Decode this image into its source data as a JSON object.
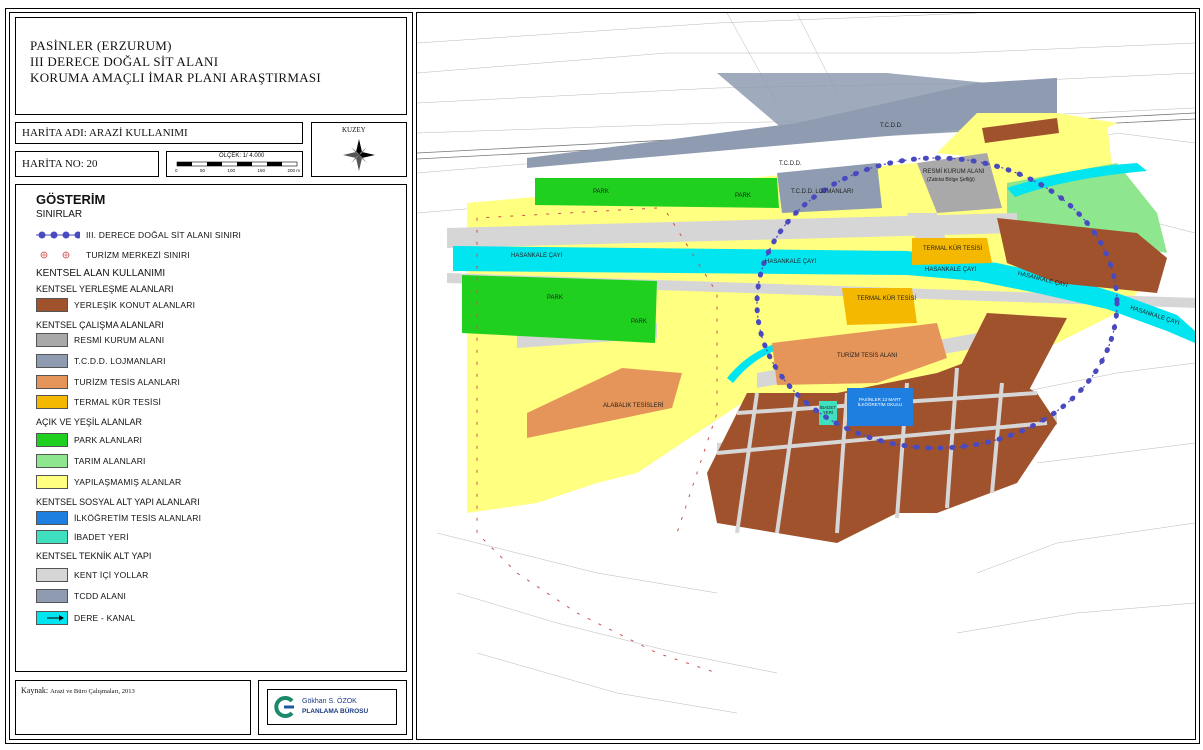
{
  "header": {
    "title_lines": [
      "PASİNLER (ERZURUM)",
      "III DERECE DOĞAL SİT ALANI",
      "KORUMA AMAÇLI İMAR PLANI ARAŞTIRMASI"
    ]
  },
  "map_name": "HARİTA ADI: ARAZİ KULLANIMI",
  "map_no": "HARİTA NO: 20",
  "scale": {
    "label": "ÖLÇEK: 1/ 4.000",
    "ticks": [
      "0",
      "50",
      "100",
      "150",
      "200 m"
    ]
  },
  "north": {
    "label": "KUZEY",
    "icon": "compass-rose-icon"
  },
  "legend": {
    "title": "GÖSTERİM",
    "boundaries_heading": "SINIRLAR",
    "boundaries": [
      {
        "label": "III. DERECE DOĞAL SİT ALANI SINIRI",
        "color": "#4a4ac0"
      },
      {
        "label": "TURİZM MERKEZİ SINIRI",
        "color": "#d05050"
      }
    ],
    "urban_heading": "KENTSEL ALAN KULLANIMI",
    "sections": [
      {
        "heading": "KENTSEL YERLEŞME ALANLARI",
        "items": [
          {
            "label": "YERLEŞİK KONUT ALANLARI",
            "color": "#a0522d"
          }
        ]
      },
      {
        "heading": "KENTSEL ÇALIŞMA ALANLARI",
        "items": [
          {
            "label": "RESMİ KURUM ALANI",
            "color": "#a9a9a9"
          },
          {
            "label": "T.C.D.D. LOJMANLARI",
            "color": "#8e9bb0"
          },
          {
            "label": "TURİZM TESİS ALANLARI",
            "color": "#e6955a"
          },
          {
            "label": "TERMAL KÜR TESİSİ",
            "color": "#f5b800"
          }
        ]
      },
      {
        "heading": "AÇIK VE YEŞİL ALANLAR",
        "items": [
          {
            "label": "PARK ALANLARI",
            "color": "#1fd01f"
          },
          {
            "label": "TARIM ALANLARI",
            "color": "#8ee68e"
          },
          {
            "label": "YAPILAŞMAMIŞ ALANLAR",
            "color": "#ffff80"
          }
        ]
      },
      {
        "heading": "KENTSEL SOSYAL ALT YAPI ALANLARI",
        "items": [
          {
            "label": "İLKÖĞRETİM TESİS ALANLARI",
            "color": "#1f7fe0"
          },
          {
            "label": "İBADET YERİ",
            "color": "#3fe0c0"
          }
        ]
      },
      {
        "heading": "KENTSEL TEKNİK ALT YAPI",
        "items": [
          {
            "label": "KENT İÇİ YOLLAR",
            "color": "#d6d6d6"
          },
          {
            "label": "TCDD ALANI",
            "color": "#8e9bb0"
          },
          {
            "label": "DERE - KANAL",
            "color": "#00e5f0"
          }
        ]
      }
    ]
  },
  "source": {
    "label": "Kaynak:",
    "text": "Arazi ve Büro Çalışmaları, 2013"
  },
  "company": {
    "line1": "Gökhan S. ÖZOK",
    "line2": "PLANLAMA BÜROSU"
  },
  "map_labels": {
    "tcdd_top": "T.C.D.D.",
    "tcdd_mid": "T.C.D.D.",
    "park1": "PARK",
    "park2": "PARK",
    "tcdd_lojman": "T.C.D.D. LOJMANLARI",
    "resmi_kurum": "RESMİ KURUM ALANI",
    "resmi_kurum_sub": "(Zabıtai Bölge Şefliği)",
    "hasankale1": "HASANKALE ÇAYI",
    "hasankale2": "HASANKALE ÇAYI",
    "hasankale3": "HASANKALE ÇAYI",
    "hasankale4": "HASANKALE ÇAYI",
    "hasankale5": "HASANKALE ÇAYI",
    "termal1": "TERMAL KÜR TESİSİ",
    "termal2": "TERMAL KÜR TESİSİ",
    "park3": "PARK",
    "park4": "PARK",
    "turizm_tesis": "TURİZM TESİS ALANI",
    "alabalik": "ALABALIK TESİSLERİ",
    "ibadet": "İBADET YERİ",
    "okul": "PASİNLER 13 MART İLKÖĞRETİM OKULU"
  }
}
